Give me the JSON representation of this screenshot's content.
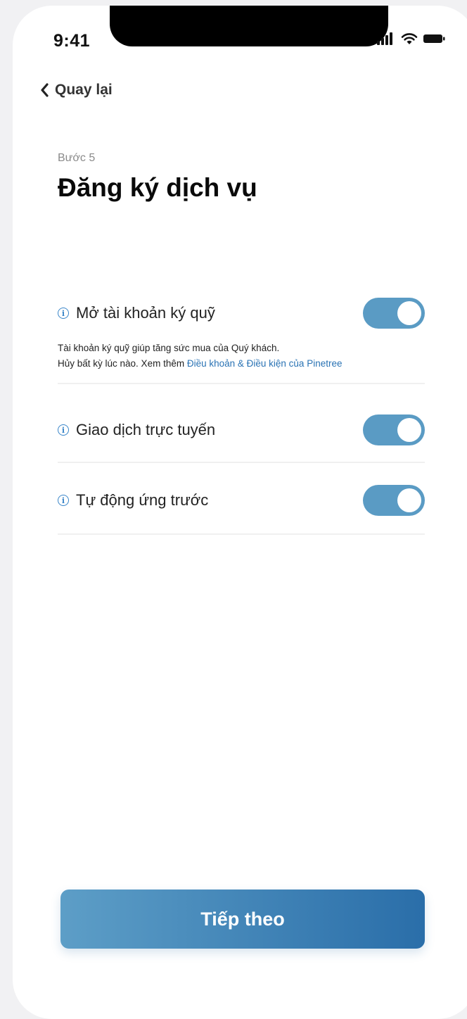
{
  "status_bar": {
    "time": "9:41"
  },
  "nav": {
    "back_label": "Quay lại"
  },
  "header": {
    "step": "Bước 5",
    "title": "Đăng ký dịch vụ"
  },
  "services": [
    {
      "label": "Mở tài khoản ký quỹ",
      "enabled": true,
      "desc_line1": "Tài khoản ký quỹ giúp tăng sức mua của Quý khách.",
      "desc_line2": "Hủy bất kỳ lúc nào. Xem thêm ",
      "desc_link": "Điều khoản & Điều kiện của Pinetree"
    },
    {
      "label": "Giao dịch trực tuyến",
      "enabled": true
    },
    {
      "label": "Tự động ứng trước",
      "enabled": true
    }
  ],
  "footer": {
    "next_label": "Tiếp theo"
  },
  "colors": {
    "accent": "#5a9bc4",
    "link": "#2a73b4",
    "button_start": "#5d9ec7",
    "button_end": "#2a6ea9"
  },
  "icons": [
    "signal-icon",
    "wifi-icon",
    "battery-icon",
    "chevron-left-icon",
    "info-icon"
  ]
}
